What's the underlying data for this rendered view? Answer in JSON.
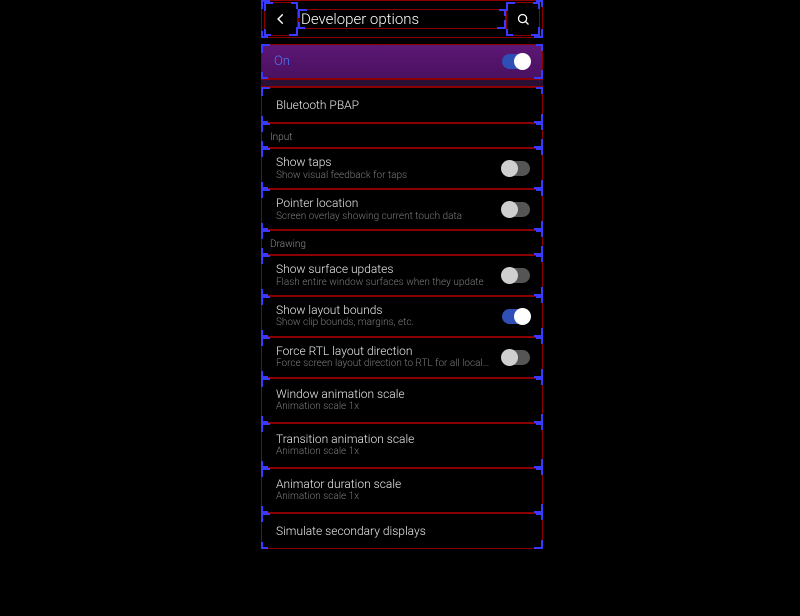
{
  "header": {
    "title": "Developer options"
  },
  "master": {
    "label": "On",
    "enabled": true
  },
  "misc_row": {
    "title": "Bluetooth PBAP"
  },
  "sections": {
    "input": {
      "label": "Input",
      "items": [
        {
          "title": "Show taps",
          "sub": "Show visual feedback for taps",
          "enabled": false
        },
        {
          "title": "Pointer location",
          "sub": "Screen overlay showing current touch data",
          "enabled": false
        }
      ]
    },
    "drawing": {
      "label": "Drawing",
      "items": [
        {
          "title": "Show surface updates",
          "sub": "Flash entire window surfaces when they update",
          "enabled": false
        },
        {
          "title": "Show layout bounds",
          "sub": "Show clip bounds, margins, etc.",
          "enabled": true
        },
        {
          "title": "Force RTL layout direction",
          "sub": "Force screen layout direction to RTL for all locales",
          "enabled": false
        },
        {
          "title": "Window animation scale",
          "sub": "Animation scale 1x"
        },
        {
          "title": "Transition animation scale",
          "sub": "Animation scale 1x"
        },
        {
          "title": "Animator duration scale",
          "sub": "Animation scale 1x"
        },
        {
          "title": "Simulate secondary displays"
        }
      ]
    }
  }
}
